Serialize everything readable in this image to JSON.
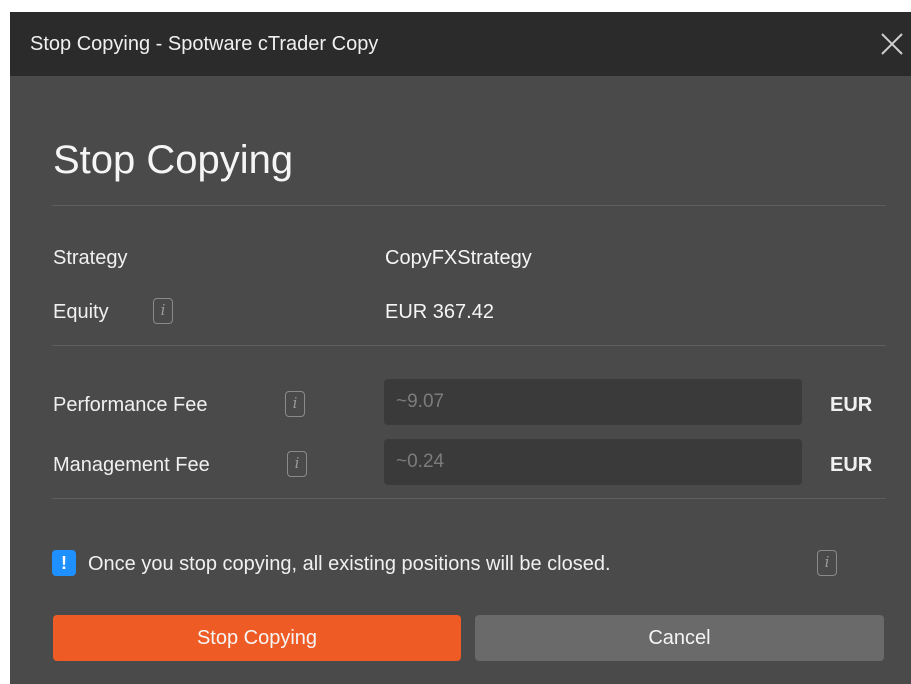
{
  "window": {
    "title": "Stop Copying - Spotware cTrader Copy",
    "close_icon": "close-icon"
  },
  "dialog": {
    "heading": "Stop Copying",
    "strategy": {
      "label": "Strategy",
      "value": "CopyFXStrategy"
    },
    "equity": {
      "label": "Equity",
      "value": "EUR 367.42",
      "info_glyph": "i"
    },
    "performance_fee": {
      "label": "Performance Fee",
      "value": "~9.07",
      "unit": "EUR",
      "info_glyph": "i"
    },
    "management_fee": {
      "label": "Management Fee",
      "value": "~0.24",
      "unit": "EUR",
      "info_glyph": "i"
    },
    "alert": {
      "glyph": "!",
      "text": "Once you stop copying, all existing positions will be closed.",
      "info_glyph": "i"
    },
    "buttons": {
      "stop_label": "Stop Copying",
      "cancel_label": "Cancel"
    }
  },
  "colors": {
    "accent": "#ef5b25",
    "alert_blue": "#1e90ff",
    "dialog_bg": "#4a4a4a",
    "titlebar_bg": "#2b2b2b"
  }
}
